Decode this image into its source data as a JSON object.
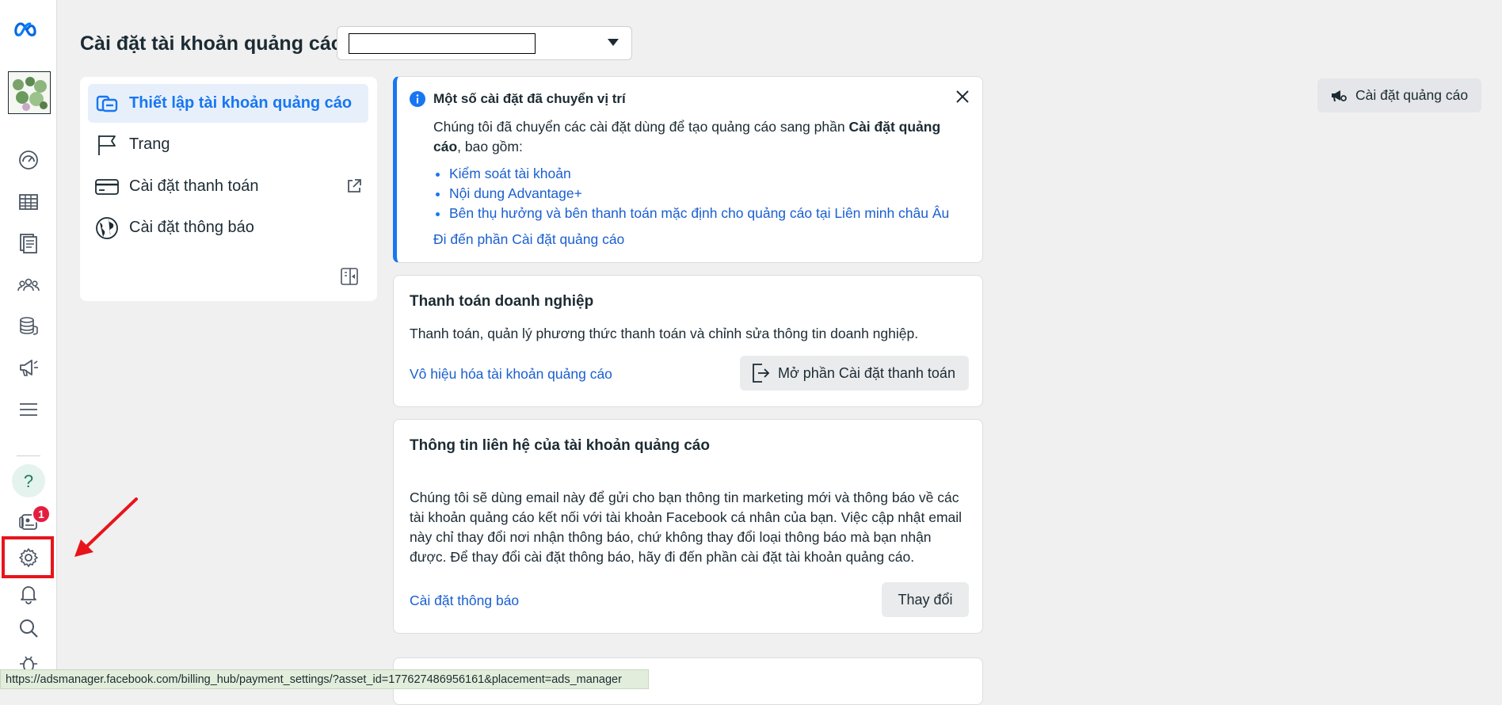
{
  "header": {
    "title": "Cài đặt tài khoản quảng cáo",
    "account_select_value": ""
  },
  "rail": {
    "items": [
      {
        "icon": "meta-logo-icon"
      },
      {
        "icon": "account-avatar"
      },
      {
        "icon": "dashboard-gauge-icon"
      },
      {
        "icon": "table-grid-icon"
      },
      {
        "icon": "reports-pages-icon"
      },
      {
        "icon": "audiences-people-icon"
      },
      {
        "icon": "billing-coins-icon"
      },
      {
        "icon": "ads-megaphone-icon"
      },
      {
        "icon": "menu-lines-icon"
      },
      {
        "icon": "help-question-icon"
      },
      {
        "icon": "news-feed-icon"
      },
      {
        "icon": "gear-icon"
      },
      {
        "icon": "bell-icon"
      },
      {
        "icon": "search-icon"
      },
      {
        "icon": "bug-icon"
      }
    ],
    "notification_badge": "1"
  },
  "settings_nav": {
    "items": [
      {
        "label": "Thiết lập tài khoản quảng cáo",
        "icon": "ad-account-setup-icon",
        "active": true
      },
      {
        "label": "Trang",
        "icon": "flag-icon",
        "active": false
      },
      {
        "label": "Cài đặt thanh toán",
        "icon": "credit-card-icon",
        "active": false,
        "external": true
      },
      {
        "label": "Cài đặt thông báo",
        "icon": "globe-icon",
        "active": false
      }
    ]
  },
  "notice": {
    "title": "Một số cài đặt đã chuyển vị trí",
    "body_prefix": "Chúng tôi đã chuyển các cài đặt dùng để tạo quảng cáo sang phần ",
    "body_bold": "Cài đặt quảng cáo",
    "body_suffix": ", bao gồm:",
    "links": [
      "Kiểm soát tài khoản",
      "Nội dung Advantage+",
      "Bên thụ hưởng và bên thanh toán mặc định cho quảng cáo tại Liên minh châu Âu"
    ],
    "go_link": "Đi đến phần Cài đặt quảng cáo"
  },
  "billing_card": {
    "title": "Thanh toán doanh nghiệp",
    "description": "Thanh toán, quản lý phương thức thanh toán và chỉnh sửa thông tin doanh nghiệp.",
    "deactivate_link": "Vô hiệu hóa tài khoản quảng cáo",
    "open_button": "Mở phần Cài đặt thanh toán"
  },
  "contact_card": {
    "title": "Thông tin liên hệ của tài khoản quảng cáo",
    "body": "Chúng tôi sẽ dùng email này để gửi cho bạn thông tin marketing mới và thông báo về các tài khoản quảng cáo kết nối với tài khoản Facebook cá nhân của bạn. Việc cập nhật email này chỉ thay đổi nơi nhận thông báo, chứ không thay đổi loại thông báo mà bạn nhận được. Để thay đổi cài đặt thông báo, hãy đi đến phần cài đặt tài khoản quảng cáo.",
    "notification_link": "Cài đặt thông báo",
    "change_button": "Thay đổi"
  },
  "top_right": {
    "ad_settings_button": "Cài đặt quảng cáo"
  },
  "status_bar": {
    "url": "https://adsmanager.facebook.com/billing_hub/payment_settings/?asset_id=177627486956161&placement=ads_manager"
  },
  "colors": {
    "accent": "#1876f2",
    "link": "#1a5fd1",
    "annotation_red": "#e8141b",
    "badge_red": "#e41e3f"
  }
}
